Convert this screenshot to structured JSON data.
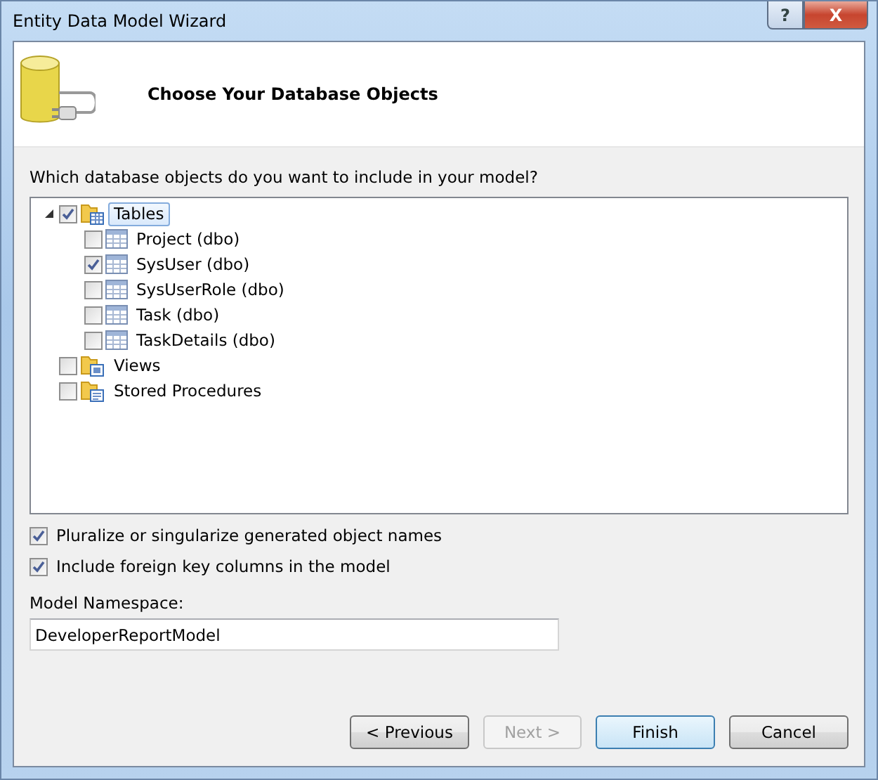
{
  "window": {
    "title": "Entity Data Model Wizard",
    "help_button": "?",
    "close_button": "X"
  },
  "header": {
    "title": "Choose Your Database Objects"
  },
  "prompt": "Which database objects do you want to include in your model?",
  "tree": [
    {
      "label": "Tables",
      "kind": "tables",
      "checked": true,
      "selected": true,
      "expanded": true,
      "children": [
        {
          "label": "Project (dbo)",
          "kind": "table",
          "checked": false,
          "selected": false
        },
        {
          "label": "SysUser (dbo)",
          "kind": "table",
          "checked": true,
          "selected": false
        },
        {
          "label": "SysUserRole (dbo)",
          "kind": "table",
          "checked": false,
          "selected": false
        },
        {
          "label": "Task (dbo)",
          "kind": "table",
          "checked": false,
          "selected": false
        },
        {
          "label": "TaskDetails (dbo)",
          "kind": "table",
          "checked": false,
          "selected": false
        }
      ]
    },
    {
      "label": "Views",
      "kind": "views",
      "checked": false,
      "selected": false
    },
    {
      "label": "Stored Procedures",
      "kind": "procedures",
      "checked": false,
      "selected": false
    }
  ],
  "options": [
    {
      "label": "Pluralize or singularize generated object names",
      "checked": true
    },
    {
      "label": "Include foreign key columns in the model",
      "checked": true
    }
  ],
  "namespace": {
    "label": "Model Namespace:",
    "value": "DeveloperReportModel"
  },
  "buttons": [
    {
      "label": "< Previous",
      "disabled": false,
      "default": false
    },
    {
      "label": "Next >",
      "disabled": true,
      "default": false
    },
    {
      "label": "Finish",
      "disabled": false,
      "default": true
    },
    {
      "label": "Cancel",
      "disabled": false,
      "default": false
    }
  ]
}
